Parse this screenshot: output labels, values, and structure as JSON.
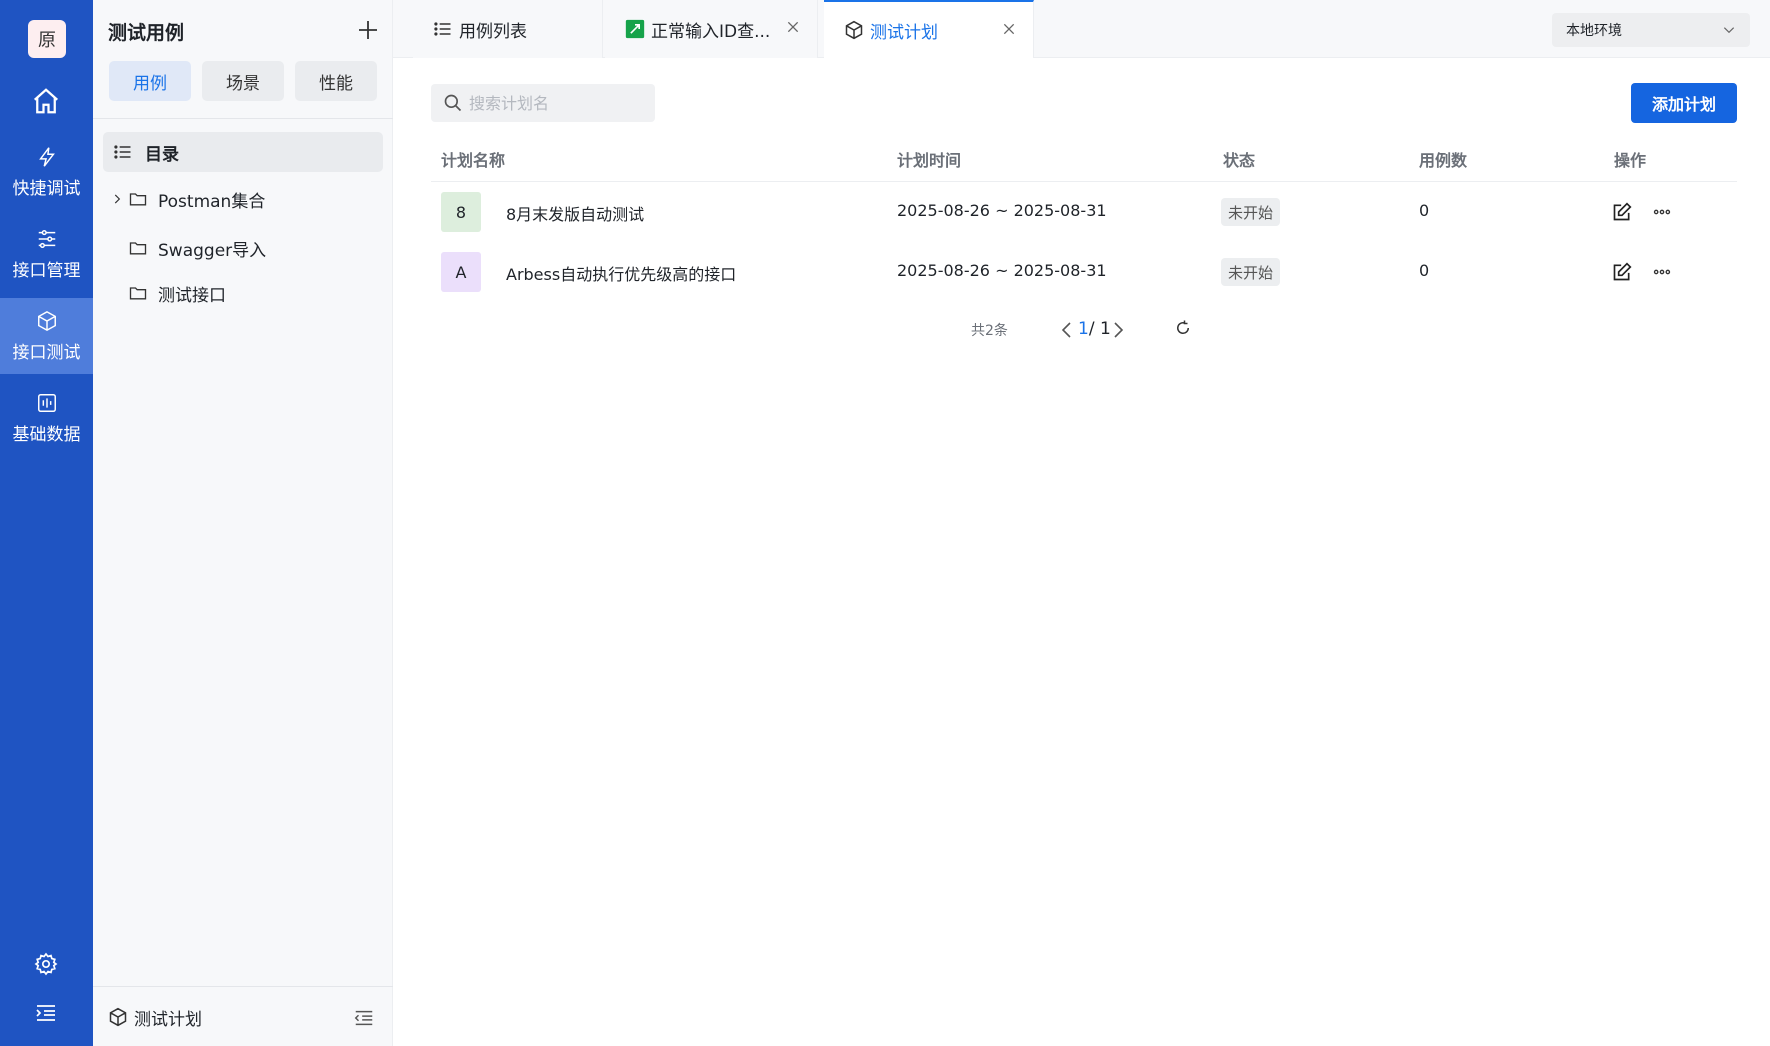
{
  "app": {
    "logo_char": "原"
  },
  "nav": {
    "items": [
      {
        "label": "快捷调试",
        "icon": "lightning-icon"
      },
      {
        "label": "接口管理",
        "icon": "sliders-icon"
      },
      {
        "label": "接口测试",
        "icon": "cube-icon",
        "active": true
      },
      {
        "label": "基础数据",
        "icon": "data-icon"
      }
    ]
  },
  "panel": {
    "title": "测试用例",
    "segments": [
      "用例",
      "场景",
      "性能"
    ],
    "active_segment": "用例",
    "tree_root": "目录",
    "tree_items": [
      "Postman集合",
      "Swagger导入",
      "测试接口"
    ],
    "footer_label": "测试计划"
  },
  "tabs": [
    {
      "label": "用例列表",
      "icon": "list-icon"
    },
    {
      "label": "正常输入ID查...",
      "icon": "api-icon",
      "closable": true
    },
    {
      "label": "测试计划",
      "icon": "cube-icon",
      "closable": true,
      "active": true
    }
  ],
  "env_select": {
    "value": "本地环境"
  },
  "search": {
    "placeholder": "搜索计划名"
  },
  "add_button": "添加计划",
  "table": {
    "headers": [
      "计划名称",
      "计划时间",
      "状态",
      "用例数",
      "操作"
    ],
    "rows": [
      {
        "avatar": "8",
        "avatar_color": "#ddeedd",
        "name": "8月末发版自动测试",
        "time": "2025-08-26 ~ 2025-08-31",
        "status": "未开始",
        "count": "0"
      },
      {
        "avatar": "A",
        "avatar_color": "#ebdffb",
        "name": "Arbess自动执行优先级高的接口",
        "time": "2025-08-26 ~ 2025-08-31",
        "status": "未开始",
        "count": "0"
      }
    ]
  },
  "pagination": {
    "total": "共2条",
    "current": "1",
    "total_pages": "/ 1"
  },
  "colors": {
    "nav_bg": "#1f54c2",
    "accent": "#1a73e8",
    "primary_button": "#1565e0"
  }
}
